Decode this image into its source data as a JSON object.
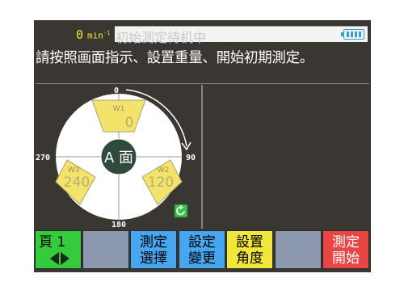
{
  "status": {
    "rpm_value": "0",
    "rpm_unit": "min",
    "rpm_unit_sup": "-1",
    "state_text": "初始測定待机中",
    "battery_icon": "battery-icon"
  },
  "instruction": "請按照画面指示、設置重量、開始初期測定。",
  "diagram": {
    "angles": {
      "top": "0",
      "right": "90",
      "bottom": "180",
      "left": "270"
    },
    "center_label": "A 面",
    "weights": [
      {
        "name": "W1",
        "value": "0"
      },
      {
        "name": "W2",
        "value": "120"
      },
      {
        "name": "W3",
        "value": "240"
      }
    ],
    "rotate_icon": "rotate-icon"
  },
  "fkeys": [
    {
      "line1": "頁 1",
      "line2": "",
      "color": "green"
    },
    {
      "line1": "",
      "line2": "",
      "color": "grey"
    },
    {
      "line1": "測定",
      "line2": "選擇",
      "color": "blue"
    },
    {
      "line1": "設定",
      "line2": "變更",
      "color": "blue"
    },
    {
      "line1": "設置",
      "line2": "角度",
      "color": "yellow"
    },
    {
      "line1": "",
      "line2": "",
      "color": "grey"
    },
    {
      "line1": "測定",
      "line2": "開始",
      "color": "red"
    }
  ],
  "colors": {
    "screen_bg": "#3a3631",
    "weight_fill": "#f3e36b",
    "hub": "#2f4a3a",
    "accent_yellow": "#f2e43a"
  }
}
